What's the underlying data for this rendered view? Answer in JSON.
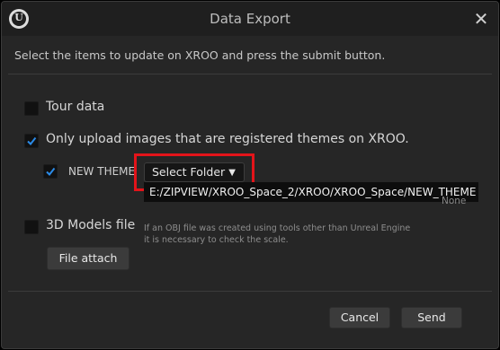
{
  "window": {
    "title": "Data Export",
    "logo_text": "U"
  },
  "instruction": "Select the items to update on XROO and press the submit button.",
  "options": {
    "tour_data": {
      "label": "Tour data",
      "checked": false
    },
    "only_registered": {
      "label": "Only upload images that are registered themes on XROO.",
      "checked": true
    },
    "new_theme": {
      "label": "NEW THEME",
      "checked": true
    },
    "models_3d": {
      "label": "3D Models file",
      "checked": false
    }
  },
  "folder": {
    "button_label": "Select Folder",
    "path": "E:/ZIPVIEW/XROO_Space_2/XROO/XROO_Space/NEW_THEME",
    "none_label": "None"
  },
  "note": {
    "line1": "If an OBJ file was created using tools other than Unreal Engine",
    "line2": "it is necessary to check the scale."
  },
  "buttons": {
    "file_attach": "File attach",
    "cancel": "Cancel",
    "send": "Send"
  },
  "colors": {
    "accent_check": "#2b8be8",
    "highlight_box": "#e3141a"
  }
}
